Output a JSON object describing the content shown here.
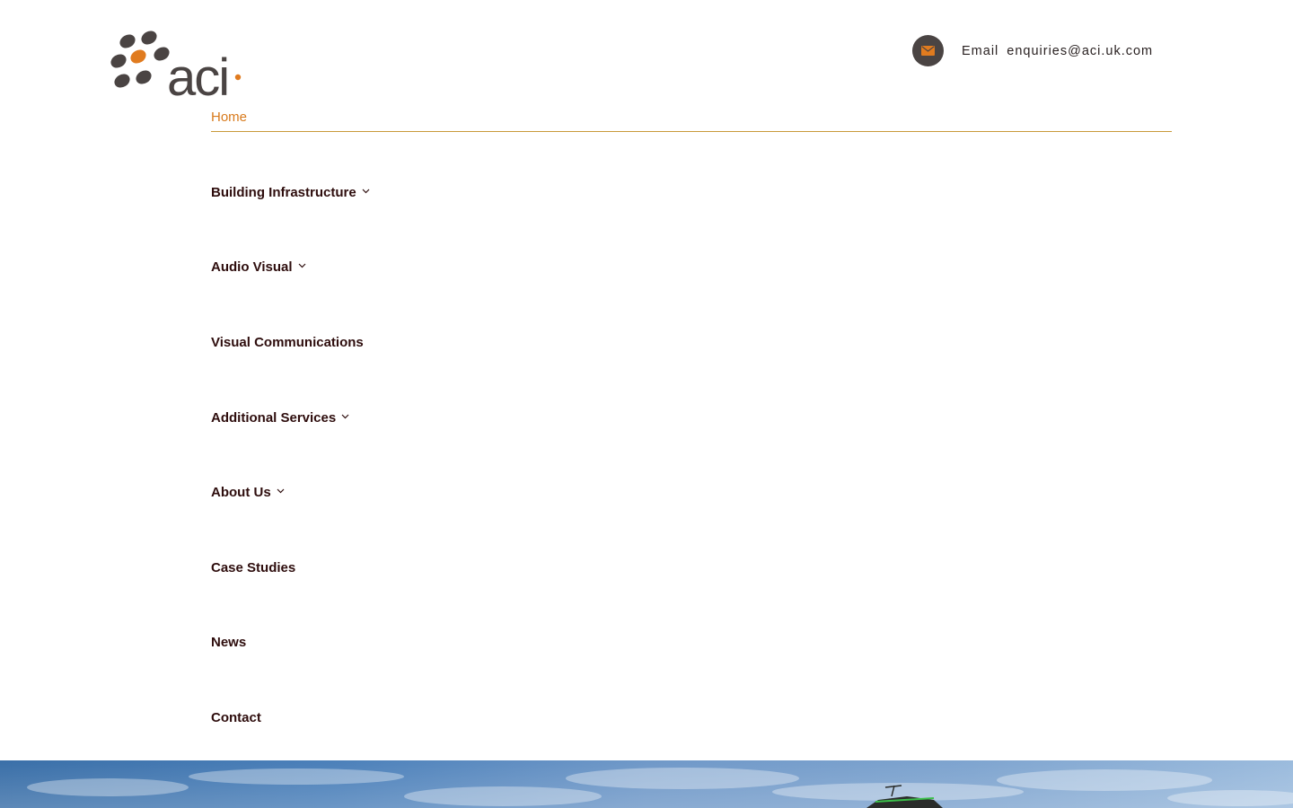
{
  "brand": {
    "name": "aci",
    "colors": {
      "accent": "#e07b1f",
      "dark": "#4a4443",
      "nav_text": "#2e0d0d",
      "rule": "#c99a3a"
    }
  },
  "header": {
    "contact_icon": "mail-icon",
    "contact_label": "Email",
    "contact_email": "enquiries@aci.uk.com"
  },
  "nav": {
    "home": "Home",
    "items": [
      {
        "label": "Building Infrastructure",
        "has_dropdown": true
      },
      {
        "label": "Audio Visual",
        "has_dropdown": true
      },
      {
        "label": "Visual Communications",
        "has_dropdown": false
      },
      {
        "label": "Additional Services",
        "has_dropdown": true
      },
      {
        "label": "About Us",
        "has_dropdown": true
      },
      {
        "label": "Case Studies",
        "has_dropdown": false
      },
      {
        "label": "News",
        "has_dropdown": false
      },
      {
        "label": "Contact",
        "has_dropdown": false
      }
    ]
  }
}
